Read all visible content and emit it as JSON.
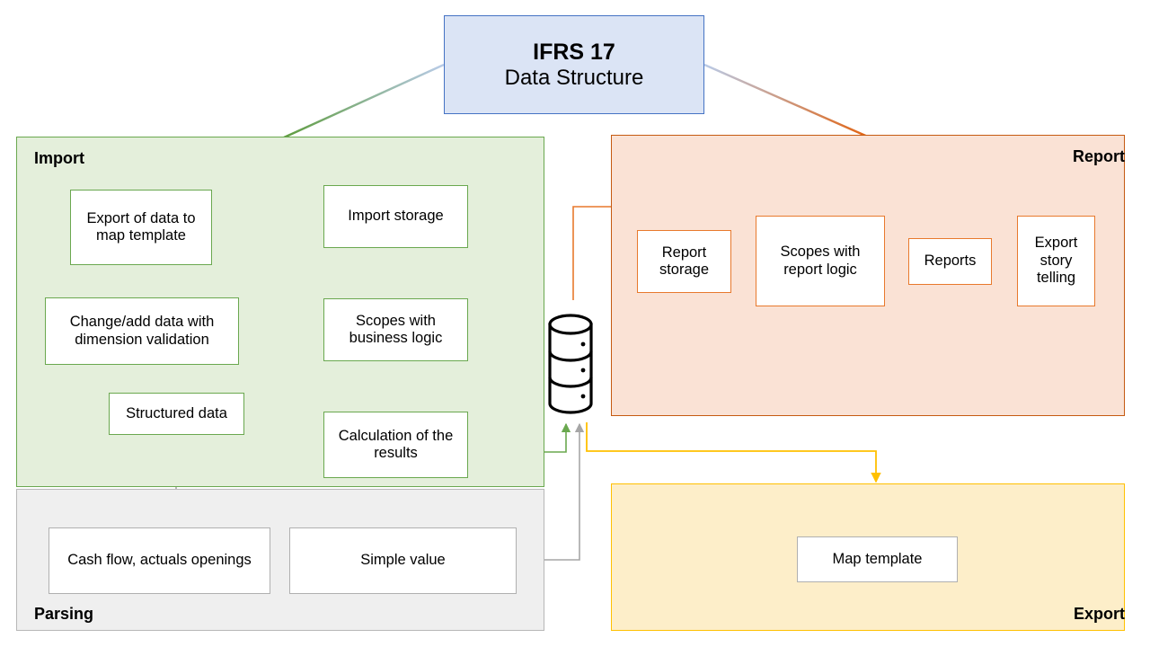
{
  "title": {
    "line1": "IFRS 17",
    "line2": "Data Structure"
  },
  "panels": {
    "import": {
      "label": "Import"
    },
    "parsing": {
      "label": "Parsing"
    },
    "report": {
      "label": "Report"
    },
    "export": {
      "label": "Export"
    }
  },
  "nodes": {
    "export_of_data": "Export of data to map template",
    "change_add_data": "Change/add data with dimension validation",
    "structured_data": "Structured data",
    "import_storage": "Import storage",
    "scopes_business": "Scopes with business logic",
    "calculation_results": "Calculation of the results",
    "cash_flow": "Cash flow, actuals openings",
    "simple_value": "Simple value",
    "report_storage": "Report storage",
    "scopes_report": "Scopes with report logic",
    "reports": "Reports",
    "export_story": "Export story telling",
    "map_template": "Map template"
  },
  "icons": {
    "database": "database-cylinder-icon"
  },
  "colors": {
    "title_fill": "#dbe4f5",
    "title_border": "#4573c4",
    "import_fill": "#e4efdb",
    "import_border": "#6aa84f",
    "parsing_fill": "#efefef",
    "parsing_border": "#b7b7b7",
    "report_fill": "#fae2d5",
    "report_border": "#c55a11",
    "export_fill": "#fdeec9",
    "export_border": "#ffc000",
    "green_arrow": "#6aa84f",
    "orange_arrow": "#e8792d",
    "gray_arrow": "#a6a6a6",
    "yellow_arrow": "#ffc000"
  }
}
